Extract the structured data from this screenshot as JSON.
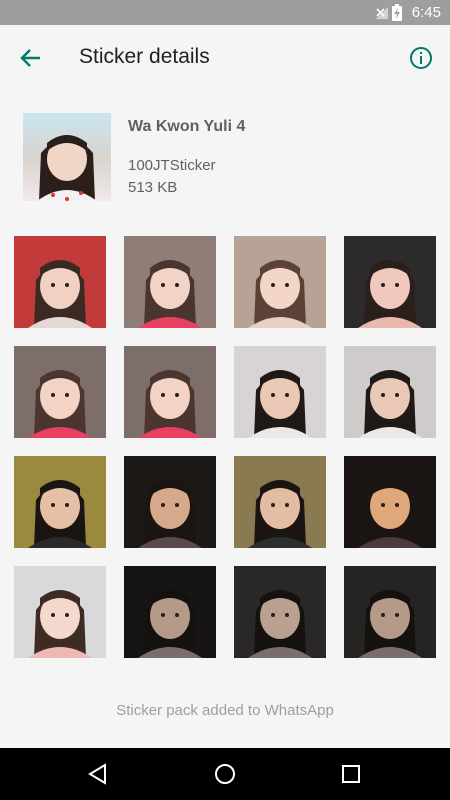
{
  "status_bar": {
    "time": "6:45"
  },
  "app_bar": {
    "title": "Sticker details"
  },
  "pack": {
    "name": "Wa Kwon Yuli 4",
    "publisher": "100JTSticker",
    "size": "513 KB"
  },
  "stickers": [
    {
      "bg": "#c23a3a",
      "skin": "#f1d2c2",
      "hair": "#3a2a24",
      "top": "#e7d8d8"
    },
    {
      "bg": "#8e7e77",
      "skin": "#f2d3c6",
      "hair": "#4a362e",
      "top": "#e84060"
    },
    {
      "bg": "#b7a296",
      "skin": "#f3d6c8",
      "hair": "#5a4236",
      "top": "#e8d0c4"
    },
    {
      "bg": "#2c2a2a",
      "skin": "#f1c8bc",
      "hair": "#2a1f1b",
      "top": "#e7b8ab"
    },
    {
      "bg": "#7e6e6b",
      "skin": "#f2d3c6",
      "hair": "#4a362e",
      "top": "#e84060"
    },
    {
      "bg": "#7e6e6b",
      "skin": "#f2d3c6",
      "hair": "#4a362e",
      "top": "#e84060"
    },
    {
      "bg": "#d8d4d4",
      "skin": "#e9c8b6",
      "hair": "#1f1a18",
      "top": "#ece8e6"
    },
    {
      "bg": "#cfcbcb",
      "skin": "#e9c8b6",
      "hair": "#1f1a18",
      "top": "#ece8e6"
    },
    {
      "bg": "#9a8a3e",
      "skin": "#e6c0a6",
      "hair": "#1a1412",
      "top": "#2a2a2a"
    },
    {
      "bg": "#1c1816",
      "skin": "#d7a98c",
      "hair": "#1a1412",
      "top": "#5a4a4a"
    },
    {
      "bg": "#8a7a52",
      "skin": "#e3bda2",
      "hair": "#1a1412",
      "top": "#2a3030"
    },
    {
      "bg": "#1a1512",
      "skin": "#e0a77a",
      "hair": "#1a1412",
      "top": "#4a3a3a"
    },
    {
      "bg": "#d9d9dc",
      "skin": "#f4d8cc",
      "hair": "#3e2c24",
      "top": "#f0b7b7"
    },
    {
      "bg": "#161514",
      "skin": "#b59a8a",
      "hair": "#14110f",
      "top": "#7a6d6d"
    },
    {
      "bg": "#2a2826",
      "skin": "#b9a090",
      "hair": "#14110f",
      "top": "#7a6d6d"
    },
    {
      "bg": "#262422",
      "skin": "#b59a8a",
      "hair": "#14110f",
      "top": "#7a6d6d"
    }
  ],
  "footer": {
    "message": "Sticker pack added to WhatsApp"
  },
  "colors": {
    "accent": "#00796b",
    "background": "#f5f5f5",
    "status_bar": "#9e9e9e"
  }
}
